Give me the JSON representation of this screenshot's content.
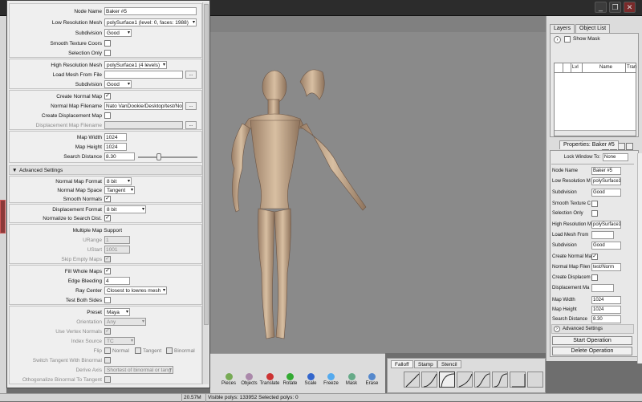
{
  "window": {
    "controls": [
      "_",
      "❐",
      "✕"
    ]
  },
  "attr": {
    "node_name": {
      "label": "Node Name",
      "value": "Baker #5"
    },
    "low_res_mesh": {
      "label": "Low Resolution Mesh",
      "value": "polySurface1 (level: 0, faces: 1988)"
    },
    "subdivision1": {
      "label": "Subdivision",
      "value": "Good"
    },
    "smooth_tex": {
      "label": "Smooth Texture Coors"
    },
    "selection_only": {
      "label": "Selection Only"
    },
    "high_res_mesh": {
      "label": "High Resolution Mesh",
      "value": "polySurface1 (4 levels)"
    },
    "load_mesh": {
      "label": "Load Mesh From File",
      "button": "..."
    },
    "subdivision2": {
      "label": "Subdivision",
      "value": "Good"
    },
    "create_normal_map": {
      "label": "Create Normal Map",
      "checked": true
    },
    "normal_map_filename": {
      "label": "Normal Map Filename",
      "value": "Nato VanDookie/Desktop/test/Norm",
      "button": "..."
    },
    "create_disp_map": {
      "label": "Create Displacement Map"
    },
    "disp_map_filename": {
      "label": "Displacement Map Filename",
      "button": "..."
    },
    "map_width": {
      "label": "Map Width",
      "value": "1024"
    },
    "map_height": {
      "label": "Map Height",
      "value": "1024"
    },
    "search_distance": {
      "label": "Search Distance",
      "value": "8.30",
      "slider": 0.35
    },
    "advanced": {
      "label": "Advanced Settings",
      "arrow": "▼"
    },
    "normal_map_format": {
      "label": "Normal Map Format",
      "value": "8 bit"
    },
    "normal_map_space": {
      "label": "Normal Map Space",
      "value": "Tangent"
    },
    "smooth_normals": {
      "label": "Smooth Normals",
      "checked": true
    },
    "disp_format": {
      "label": "Displacement Format",
      "value": "8 bit"
    },
    "normalize": {
      "label": "Normalize to Search Dist.",
      "checked": true
    },
    "multi_map": {
      "title": "Multiple Map Support"
    },
    "urange": {
      "label": "URange",
      "value": "1"
    },
    "ustart": {
      "label": "UStart",
      "value": "1001"
    },
    "skip_empty": {
      "label": "Skip Empty Maps",
      "checked": true
    },
    "fill_whole": {
      "label": "Fill Whole Maps",
      "checked": true
    },
    "edge_bleeding": {
      "label": "Edge Bleeding",
      "value": "4"
    },
    "ray_center": {
      "label": "Ray Center",
      "value": "Closest to lowres mesh"
    },
    "test_both": {
      "label": "Test Both Sides"
    },
    "preset": {
      "label": "Preset",
      "value": "Maya"
    },
    "orientation": {
      "label": "Orientation",
      "value": "Any"
    },
    "use_vertex_normals": {
      "label": "Use Vertex Normals",
      "checked": true
    },
    "index_source": {
      "label": "Index Source",
      "value": "TC"
    },
    "flip": {
      "label": "Flip",
      "opts": [
        "Normal",
        "Tangent",
        "Binormal"
      ]
    },
    "switch_tangent": {
      "label": "Switch Tangent With Binormal"
    },
    "derive_axis": {
      "label": "Derive Axis",
      "value": "Shortest of binormal or tang"
    },
    "orthogonalize": {
      "label": "Othogonalize Binormal To Tangent"
    }
  },
  "right": {
    "tabs": [
      "Layers",
      "Object List"
    ],
    "show_mask": "Show Mask",
    "layer_cols": [
      "Lvl",
      "Name",
      "Tran"
    ],
    "properties_tab": "Properties: Baker #5",
    "lock_window": {
      "label": "Lock Window To:",
      "value": "None"
    },
    "rows": [
      {
        "label": "Node Name",
        "value": "Baker #5"
      },
      {
        "label": "Low Resolution M",
        "value": "polySurface1 (levels"
      },
      {
        "label": "Subdivision",
        "value": "Good"
      },
      {
        "label": "Smooth Texture C"
      },
      {
        "label": "Selection Only"
      },
      {
        "label": "High Resolution M",
        "value": "polySurface1 (4 levels"
      },
      {
        "label": "Load Mesh From"
      },
      {
        "label": "Subdivision",
        "value": "Good"
      },
      {
        "label": "Create Normal Ma"
      },
      {
        "label": "Normal Map Filen",
        "value": "test/Norm"
      },
      {
        "label": "Create Displacem"
      },
      {
        "label": "Displacement Ma"
      },
      {
        "label": "Map Width",
        "value": "1024"
      },
      {
        "label": "Map Height",
        "value": "1024"
      },
      {
        "label": "Search Distance",
        "value": "8.30"
      }
    ],
    "advanced": "Advanced Settings",
    "start_op": "Start Operation",
    "delete_op": "Delete Operation"
  },
  "toolbar": {
    "tools": [
      {
        "label": "Pieces",
        "icon": "pieces-icon",
        "color": "#7a5"
      },
      {
        "label": "Objects",
        "icon": "objects-icon",
        "color": "#a8a"
      },
      {
        "label": "Translate",
        "icon": "translate-icon",
        "color": "#c33"
      },
      {
        "label": "Rotate",
        "icon": "rotate-icon",
        "color": "#3a3"
      },
      {
        "label": "Scale",
        "icon": "scale-icon",
        "color": "#36c"
      },
      {
        "label": "Freeze",
        "icon": "freeze-icon",
        "color": "#5ae"
      },
      {
        "label": "Mask",
        "icon": "mask-icon",
        "color": "#6a8"
      },
      {
        "label": "Erase",
        "icon": "erase-icon",
        "color": "#58c"
      }
    ]
  },
  "falloff": {
    "tabs": [
      "Falloff",
      "Stamp",
      "Stencil"
    ]
  },
  "status": {
    "memory": "20.57M",
    "polys": "Visible polys: 133952  Selected polys: 0"
  }
}
